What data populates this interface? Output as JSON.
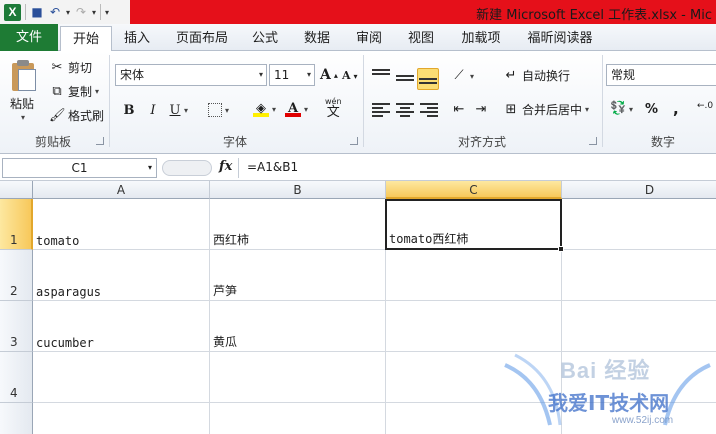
{
  "window": {
    "title": "新建 Microsoft Excel 工作表.xlsx - Mic",
    "app_icon": "X"
  },
  "tabs": [
    {
      "label": "文件"
    },
    {
      "label": "开始"
    },
    {
      "label": "插入"
    },
    {
      "label": "页面布局"
    },
    {
      "label": "公式"
    },
    {
      "label": "数据"
    },
    {
      "label": "审阅"
    },
    {
      "label": "视图"
    },
    {
      "label": "加载项"
    },
    {
      "label": "福昕阅读器"
    }
  ],
  "ribbon": {
    "clipboard": {
      "paste": "粘贴",
      "cut": "剪切",
      "copy": "复制",
      "format_painter": "格式刷",
      "label": "剪贴板"
    },
    "font": {
      "name": "宋体",
      "size": "11",
      "grow": "A",
      "shrink": "A",
      "bold": "B",
      "italic": "I",
      "underline": "U",
      "wen": "wén",
      "wen_char": "文",
      "label": "字体"
    },
    "alignment": {
      "wrap": "自动换行",
      "merge": "合并后居中",
      "label": "对齐方式"
    },
    "number": {
      "format": "常规",
      "percent": "%",
      "comma": ",",
      "label": "数字"
    }
  },
  "formula_bar": {
    "name_box": "C1",
    "fx": "fx",
    "formula": "=A1&B1"
  },
  "columns": [
    "A",
    "B",
    "C",
    "D"
  ],
  "rows": [
    "1",
    "2",
    "3",
    "4"
  ],
  "cells": {
    "A1": "tomato",
    "B1": "西红柿",
    "C1": "tomato西红柿",
    "A2": "asparagus",
    "B2": "芦笋",
    "A3": "cucumber",
    "B3": "黄瓜"
  },
  "watermark": {
    "logo": "Bai 经验",
    "text": "我爱IT技术网",
    "url": "www.52ij.com"
  },
  "colors": {
    "title_bar": "#e5101a",
    "file_tab": "#1e7b34",
    "selection_header": "#f7c85b"
  }
}
